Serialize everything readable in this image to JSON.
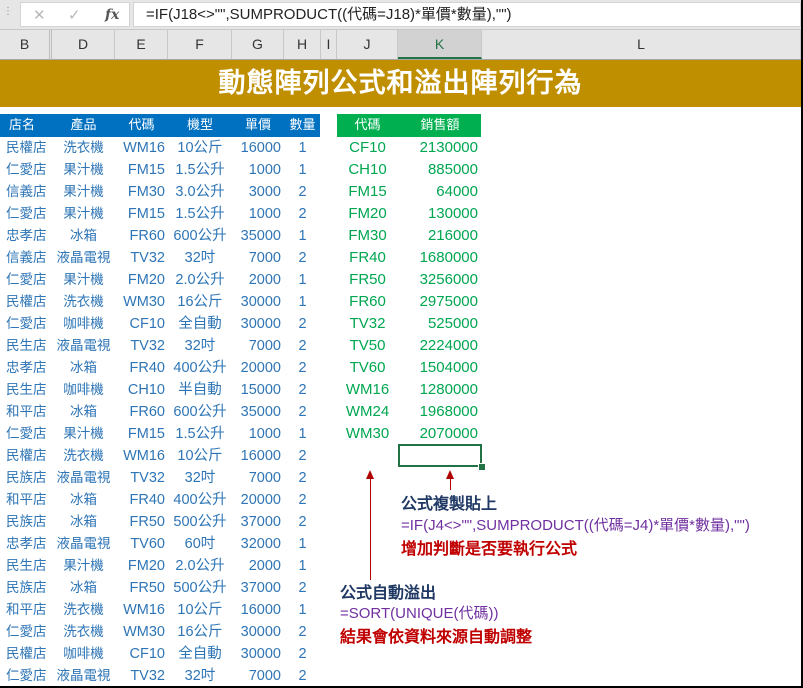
{
  "formula_bar": {
    "cancel_icon": "close-icon",
    "enter_icon": "check-icon",
    "fx_label": "fx",
    "formula": "=IF(J18<>\"\",SUMPRODUCT((代碼=J18)*單價*數量),\"\")"
  },
  "column_headers": [
    "B",
    "D",
    "E",
    "F",
    "G",
    "H",
    "I",
    "J",
    "K",
    "L"
  ],
  "selected_column": "K",
  "title": "動態陣列公式和溢出陣列行為",
  "colors": {
    "title_band": "#C08F00",
    "source_header": "#0070C0",
    "output_header": "#00B050",
    "source_text": "#2E75B6",
    "output_text": "#00A650",
    "selection": "#217346",
    "annotation_title": "#1F3864",
    "annotation_formula": "#7030A0",
    "annotation_note": "#C00000"
  },
  "source_table": {
    "headers": [
      "店名",
      "產品",
      "代碼",
      "機型",
      "單價",
      "數量"
    ],
    "rows": [
      [
        "民權店",
        "洗衣機",
        "WM16",
        "10公斤",
        "16000",
        "1"
      ],
      [
        "仁愛店",
        "果汁機",
        "FM15",
        "1.5公升",
        "1000",
        "1"
      ],
      [
        "信義店",
        "果汁機",
        "FM30",
        "3.0公升",
        "3000",
        "2"
      ],
      [
        "仁愛店",
        "果汁機",
        "FM15",
        "1.5公升",
        "1000",
        "2"
      ],
      [
        "忠孝店",
        "冰箱",
        "FR60",
        "600公升",
        "35000",
        "1"
      ],
      [
        "信義店",
        "液晶電視",
        "TV32",
        "32吋",
        "7000",
        "2"
      ],
      [
        "仁愛店",
        "果汁機",
        "FM20",
        "2.0公升",
        "2000",
        "1"
      ],
      [
        "民權店",
        "洗衣機",
        "WM30",
        "16公斤",
        "30000",
        "1"
      ],
      [
        "仁愛店",
        "咖啡機",
        "CF10",
        "全自動",
        "30000",
        "2"
      ],
      [
        "民生店",
        "液晶電視",
        "TV32",
        "32吋",
        "7000",
        "2"
      ],
      [
        "忠孝店",
        "冰箱",
        "FR40",
        "400公升",
        "20000",
        "2"
      ],
      [
        "民生店",
        "咖啡機",
        "CH10",
        "半自動",
        "15000",
        "2"
      ],
      [
        "和平店",
        "冰箱",
        "FR60",
        "600公升",
        "35000",
        "2"
      ],
      [
        "仁愛店",
        "果汁機",
        "FM15",
        "1.5公升",
        "1000",
        "1"
      ],
      [
        "民權店",
        "洗衣機",
        "WM16",
        "10公斤",
        "16000",
        "2"
      ],
      [
        "民族店",
        "液晶電視",
        "TV32",
        "32吋",
        "7000",
        "2"
      ],
      [
        "和平店",
        "冰箱",
        "FR40",
        "400公升",
        "20000",
        "2"
      ],
      [
        "民族店",
        "冰箱",
        "FR50",
        "500公升",
        "37000",
        "2"
      ],
      [
        "忠孝店",
        "液晶電視",
        "TV60",
        "60吋",
        "32000",
        "1"
      ],
      [
        "民生店",
        "果汁機",
        "FM20",
        "2.0公升",
        "2000",
        "1"
      ],
      [
        "民族店",
        "冰箱",
        "FR50",
        "500公升",
        "37000",
        "2"
      ],
      [
        "和平店",
        "洗衣機",
        "WM16",
        "10公斤",
        "16000",
        "1"
      ],
      [
        "仁愛店",
        "洗衣機",
        "WM30",
        "16公斤",
        "30000",
        "2"
      ],
      [
        "民權店",
        "咖啡機",
        "CF10",
        "全自動",
        "30000",
        "2"
      ],
      [
        "仁愛店",
        "液晶電視",
        "TV32",
        "32吋",
        "7000",
        "2"
      ]
    ]
  },
  "output_table": {
    "headers": [
      "代碼",
      "銷售額"
    ],
    "rows": [
      [
        "CF10",
        "2130000"
      ],
      [
        "CH10",
        "885000"
      ],
      [
        "FM15",
        "64000"
      ],
      [
        "FM20",
        "130000"
      ],
      [
        "FM30",
        "216000"
      ],
      [
        "FR40",
        "1680000"
      ],
      [
        "FR50",
        "3256000"
      ],
      [
        "FR60",
        "2975000"
      ],
      [
        "TV32",
        "525000"
      ],
      [
        "TV50",
        "2224000"
      ],
      [
        "TV60",
        "1504000"
      ],
      [
        "WM16",
        "1280000"
      ],
      [
        "WM24",
        "1968000"
      ],
      [
        "WM30",
        "2070000"
      ]
    ]
  },
  "annotations": {
    "paste": {
      "title": "公式複製貼上",
      "formula": "=IF(J4<>\"\",SUMPRODUCT((代碼=J4)*單價*數量),\"\")",
      "note": "增加判斷是否要執行公式"
    },
    "spill": {
      "title": "公式自動溢出",
      "formula": "=SORT(UNIQUE(代碼))",
      "note": "結果會依資料來源自動調整"
    }
  }
}
